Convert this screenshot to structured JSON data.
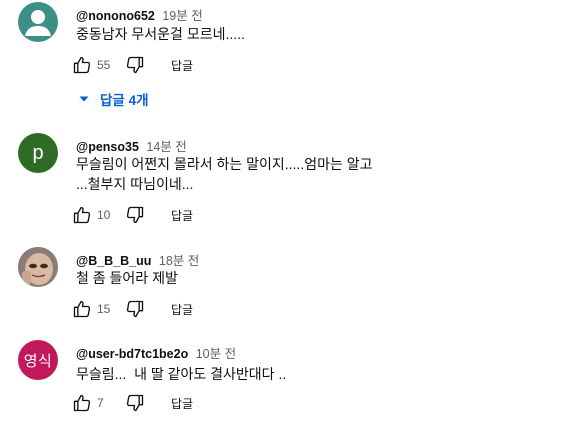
{
  "comments": [
    {
      "author": "@nonono652",
      "time": "19분 전",
      "lines": [
        "중동남자 무서운걸 모르네....."
      ],
      "likes": "55",
      "reply_label": "답글",
      "replies_label": "답글 4개",
      "avatar": {
        "kind": "default",
        "color": "#3d8f85"
      }
    },
    {
      "author": "@penso35",
      "time": "14분 전",
      "lines": [
        "무슬림이 어쩐지 몰라서 하는 말이지.....엄마는 알고",
        "...철부지 따님이네..."
      ],
      "likes": "10",
      "reply_label": "답글",
      "avatar": {
        "kind": "letter",
        "text": "p",
        "color": "#2e6b24"
      }
    },
    {
      "author": "@B_B_B_uu",
      "time": "18분 전",
      "lines": [
        "철 좀 들어라 제발"
      ],
      "likes": "15",
      "reply_label": "답글",
      "avatar": {
        "kind": "photo",
        "color": "#b89a87"
      }
    },
    {
      "author": "@user-bd7tc1be2o",
      "time": "10분 전",
      "lines": [
        "무슬림...  내 딸 같아도 결사반대다 .."
      ],
      "likes": "7",
      "reply_label": "답글",
      "avatar": {
        "kind": "text",
        "text": "영식",
        "color": "#c2185b"
      }
    }
  ],
  "icons": {
    "like": "thumbs-up-icon",
    "dislike": "thumbs-down-icon",
    "replies_toggle": "caret-down-icon"
  },
  "colors": {
    "link": "#065fd4",
    "secondary_text": "#606060",
    "primary_text": "#0f0f0f"
  }
}
